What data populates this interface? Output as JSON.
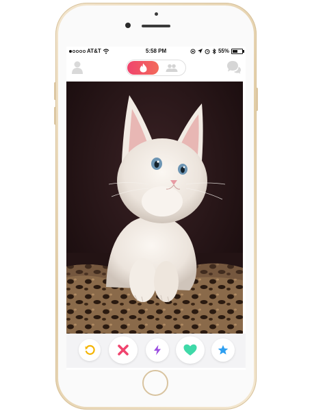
{
  "status_bar": {
    "carrier": "AT&T",
    "time": "5:58 PM",
    "battery": "55%",
    "battery_level": 0.55
  },
  "header": {
    "profile_icon": "person-icon",
    "toggle_left_icon": "flame-icon",
    "toggle_right_icon": "group-icon",
    "messages_icon": "chat-bubbles-icon",
    "accent_color": "#f0446e"
  },
  "card": {
    "image_subject": "white-kitten-photo"
  },
  "actions": [
    {
      "name": "rewind-button",
      "icon": "rewind-icon",
      "color": "#f5b400"
    },
    {
      "name": "nope-button",
      "icon": "x-icon",
      "color": "#f0446e"
    },
    {
      "name": "boost-button",
      "icon": "lightning-icon",
      "color": "#9b4de0"
    },
    {
      "name": "like-button",
      "icon": "heart-icon",
      "color": "#3fd9a8"
    },
    {
      "name": "super-like-button",
      "icon": "star-icon",
      "color": "#2e9ff0"
    }
  ]
}
